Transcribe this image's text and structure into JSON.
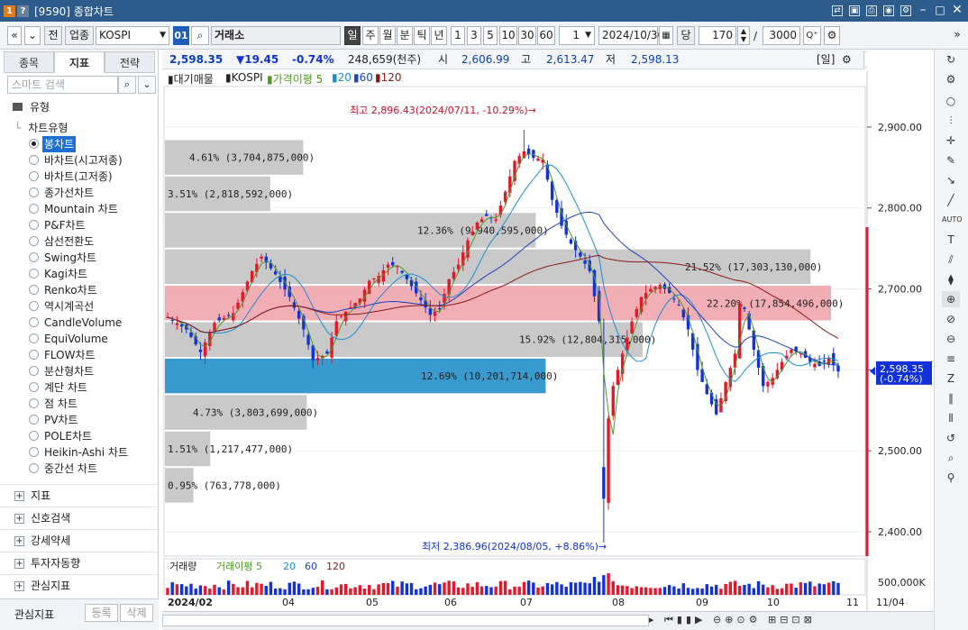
{
  "window": {
    "badge1": "1",
    "badge2": "?",
    "title": "[9590] 종합차트"
  },
  "toolbar": {
    "prev": "«",
    "next": "»",
    "jeon": "전",
    "upjong": "업종",
    "market": "KOSPI",
    "code": "01",
    "search_icon": "⌕",
    "exchange": "거래소",
    "periods": [
      "일",
      "주",
      "월",
      "분",
      "틱",
      "년"
    ],
    "intervals": [
      "1",
      "3",
      "5",
      "10",
      "30",
      "60"
    ],
    "count_sel": "1",
    "date": "2024/10/30",
    "dang": "당",
    "bars": "170",
    "slash": "/",
    "total": "3000",
    "plus": "Q⁺"
  },
  "leftpanel": {
    "tabs": [
      "종목",
      "지표",
      "전략"
    ],
    "search_placeholder": "스마트 검색",
    "section": "유형",
    "subsection": "차트유형",
    "chart_types": [
      "봉차트",
      "바차트(시고저종)",
      "바차트(고저종)",
      "종가선차트",
      "Mountain 차트",
      "P&F차트",
      "삼선전환도",
      "Swing차트",
      "Kagi차트",
      "Renko차트",
      "역시계곡선",
      "CandleVolume",
      "EquiVolume",
      "FLOW차트",
      "분산형차트",
      "계단 차트",
      "점 차트",
      "PV차트",
      "POLE차트",
      "Heikin-Ashi 차트",
      "중간선 차트"
    ],
    "groups": [
      "지표",
      "신호검색",
      "강세약세",
      "투자자동향",
      "관심지표"
    ],
    "footer_label": "관심지표",
    "register": "등록",
    "delete": "삭제"
  },
  "infobar": {
    "price": "2,598.35",
    "change": "▼19.45",
    "pct": "-0.74%",
    "volume": "248,659(천주)",
    "open_label": "시",
    "open": "2,606.99",
    "high_label": "고",
    "high": "2,613.47",
    "low_label": "저",
    "low": "2,598.13",
    "period_tag": "[일]",
    "buy": "매수",
    "sell": "매도"
  },
  "legend": {
    "candle": "대기매물",
    "name": "KOSPI",
    "ma_label": "가격이평 5",
    "ma20": "20",
    "ma60": "60",
    "ma120": "120"
  },
  "volume_legend": {
    "label": "거래량",
    "ma_label": "거래이평 5",
    "ma20": "20",
    "ma60": "60",
    "ma120": "120"
  },
  "colors": {
    "up": "#e8162b",
    "down": "#1231d8",
    "ma5": "#4d9a23",
    "ma20": "#1c8fd2",
    "ma60": "#1f43b8",
    "ma120": "#8a1a1a",
    "profile_gray": "#c6c6c6",
    "profile_red": "#eea0a8",
    "profile_blue": "#2e95cc"
  },
  "chart_data": {
    "type": "candlestick",
    "ylim": [
      2370,
      2950
    ],
    "yticks": [
      "2,900.00",
      "2,800.00",
      "2,700.00",
      "2,600.00",
      "2,500.00",
      "2,400.00"
    ],
    "ytick_values": [
      2900,
      2800,
      2700,
      2600,
      2500,
      2400
    ],
    "xticks": [
      "2024/02",
      "04",
      "05",
      "06",
      "07",
      "08",
      "09",
      "10",
      "11"
    ],
    "last_price": "2,598.35",
    "last_pct": "(-0.74%)",
    "high_annotation": "최고 2,896.43(2024/07/11, -10.29%)→",
    "low_annotation": "최저 2,386.96(2024/08/05, +8.86%)→",
    "volume_axis_label": "500,000K",
    "date_label": "11/04",
    "volume_profile": [
      {
        "price_low": 2840,
        "price_high": 2885,
        "label": "4.61% (3,704,875,000)",
        "pct": 4.61
      },
      {
        "price_low": 2795,
        "price_high": 2840,
        "label": "3.51% (2,818,592,000)",
        "pct": 3.51
      },
      {
        "price_low": 2750,
        "price_high": 2795,
        "label": "12.36% (9,940,595,000)",
        "pct": 12.36
      },
      {
        "price_low": 2705,
        "price_high": 2750,
        "label": "21.52% (17,303,130,000)",
        "pct": 21.52
      },
      {
        "price_low": 2660,
        "price_high": 2705,
        "label": "22.20% (17,854,496,000)",
        "pct": 22.2
      },
      {
        "price_low": 2615,
        "price_high": 2660,
        "label": "15.92% (12,804,315,000)",
        "pct": 15.92
      },
      {
        "price_low": 2570,
        "price_high": 2615,
        "label": "12.69% (10,201,714,000)",
        "pct": 12.69
      },
      {
        "price_low": 2525,
        "price_high": 2570,
        "label": "4.73% (3,803,699,000)",
        "pct": 4.73
      },
      {
        "price_low": 2480,
        "price_high": 2525,
        "label": "1.51% (1,217,477,000)",
        "pct": 1.51
      },
      {
        "price_low": 2435,
        "price_high": 2480,
        "label": "0.95% (763,778,000)",
        "pct": 0.95
      }
    ],
    "close_path": [
      [
        0,
        2665
      ],
      [
        8,
        2650
      ],
      [
        14,
        2622
      ],
      [
        20,
        2658
      ],
      [
        28,
        2670
      ],
      [
        36,
        2722
      ],
      [
        40,
        2740
      ],
      [
        46,
        2718
      ],
      [
        52,
        2690
      ],
      [
        58,
        2650
      ],
      [
        62,
        2612
      ],
      [
        68,
        2620
      ],
      [
        72,
        2660
      ],
      [
        76,
        2672
      ],
      [
        82,
        2688
      ],
      [
        86,
        2710
      ],
      [
        90,
        2716
      ],
      [
        94,
        2730
      ],
      [
        98,
        2728
      ],
      [
        102,
        2712
      ],
      [
        108,
        2686
      ],
      [
        112,
        2668
      ],
      [
        116,
        2676
      ],
      [
        120,
        2712
      ],
      [
        124,
        2730
      ],
      [
        128,
        2760
      ],
      [
        132,
        2782
      ],
      [
        136,
        2790
      ],
      [
        140,
        2786
      ],
      [
        144,
        2820
      ],
      [
        148,
        2858
      ],
      [
        152,
        2870
      ],
      [
        156,
        2862
      ],
      [
        160,
        2860
      ],
      [
        164,
        2810
      ],
      [
        168,
        2778
      ],
      [
        172,
        2756
      ],
      [
        176,
        2740
      ],
      [
        180,
        2722
      ],
      [
        184,
        2660
      ],
      [
        186,
        2441
      ],
      [
        188,
        2540
      ],
      [
        190,
        2580
      ],
      [
        194,
        2620
      ],
      [
        198,
        2660
      ],
      [
        202,
        2690
      ],
      [
        206,
        2700
      ],
      [
        210,
        2705
      ],
      [
        214,
        2695
      ],
      [
        218,
        2680
      ],
      [
        222,
        2650
      ],
      [
        226,
        2600
      ],
      [
        230,
        2570
      ],
      [
        234,
        2545
      ],
      [
        238,
        2585
      ],
      [
        242,
        2620
      ],
      [
        244,
        2682
      ],
      [
        246,
        2675
      ],
      [
        250,
        2625
      ],
      [
        254,
        2580
      ],
      [
        258,
        2590
      ],
      [
        262,
        2610
      ],
      [
        266,
        2625
      ],
      [
        270,
        2620
      ],
      [
        274,
        2610
      ],
      [
        278,
        2605
      ],
      [
        282,
        2615
      ],
      [
        286,
        2598
      ]
    ]
  }
}
